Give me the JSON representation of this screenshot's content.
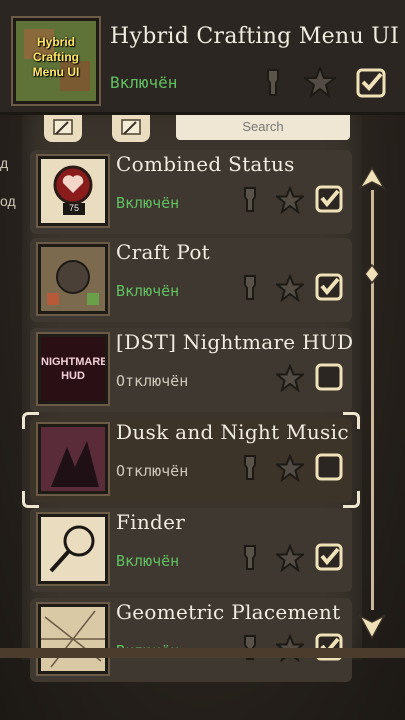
{
  "header": {
    "title": "Hybrid Crafting Menu UI",
    "thumb_text": "Hybrid Crafting Menu UI",
    "status": "Включён"
  },
  "search": {
    "placeholder": "Search"
  },
  "side_labels": [
    "д",
    "од"
  ],
  "mods": [
    {
      "title": "Combined Status",
      "status": "Включён",
      "enabled": true,
      "thumb_label": "75"
    },
    {
      "title": "Craft Pot",
      "status": "Включён",
      "enabled": true
    },
    {
      "title": "[DST] Nightmare HUD",
      "status": "Отключён",
      "enabled": false,
      "thumb_text": "NIGHTMARE HUD"
    },
    {
      "title": "Dusk and Night Music",
      "status": "Отключён",
      "enabled": false
    },
    {
      "title": "Finder",
      "status": "Включён",
      "enabled": true
    },
    {
      "title": "Geometric Placement",
      "status": "Включён",
      "enabled": true
    }
  ],
  "colors": {
    "enabled": "#61c060",
    "disabled": "#cfc8bb",
    "checkbox": "#f0e2b8"
  },
  "icons": [
    "wrench-icon",
    "star-icon",
    "checkbox-icon",
    "scroll-up-arrow-icon",
    "scroll-down-arrow-icon",
    "scroll-thumb-icon"
  ]
}
